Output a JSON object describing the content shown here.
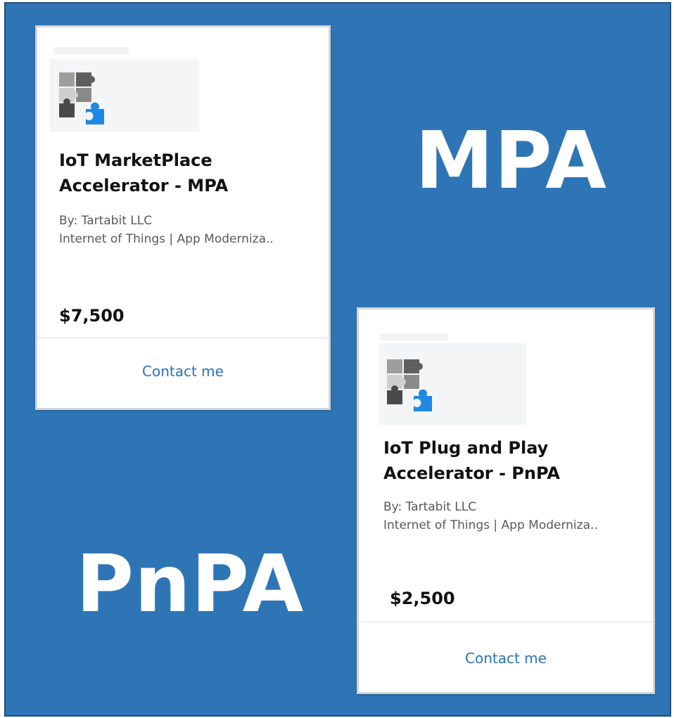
{
  "overlay": {
    "mpa_label": "MPA",
    "pnpa_label": "PnPA"
  },
  "colors": {
    "background_blue": "#2e75b6",
    "link_blue": "#2d72b8",
    "puzzle_blue": "#1e88e5"
  },
  "cards": [
    {
      "icon": "puzzle-pieces-icon",
      "title_line1": "IoT MarketPlace",
      "title_line2": "Accelerator - MPA",
      "publisher": "By: Tartabit LLC",
      "categories": "Internet of Things | App Moderniza..",
      "price": "$7,500",
      "action_label": "Contact me"
    },
    {
      "icon": "puzzle-pieces-icon",
      "title_line1": "IoT Plug and Play",
      "title_line2": "Accelerator - PnPA",
      "publisher": "By: Tartabit LLC",
      "categories": "Internet of Things | App Moderniza..",
      "price": "$2,500",
      "action_label": "Contact me"
    }
  ]
}
